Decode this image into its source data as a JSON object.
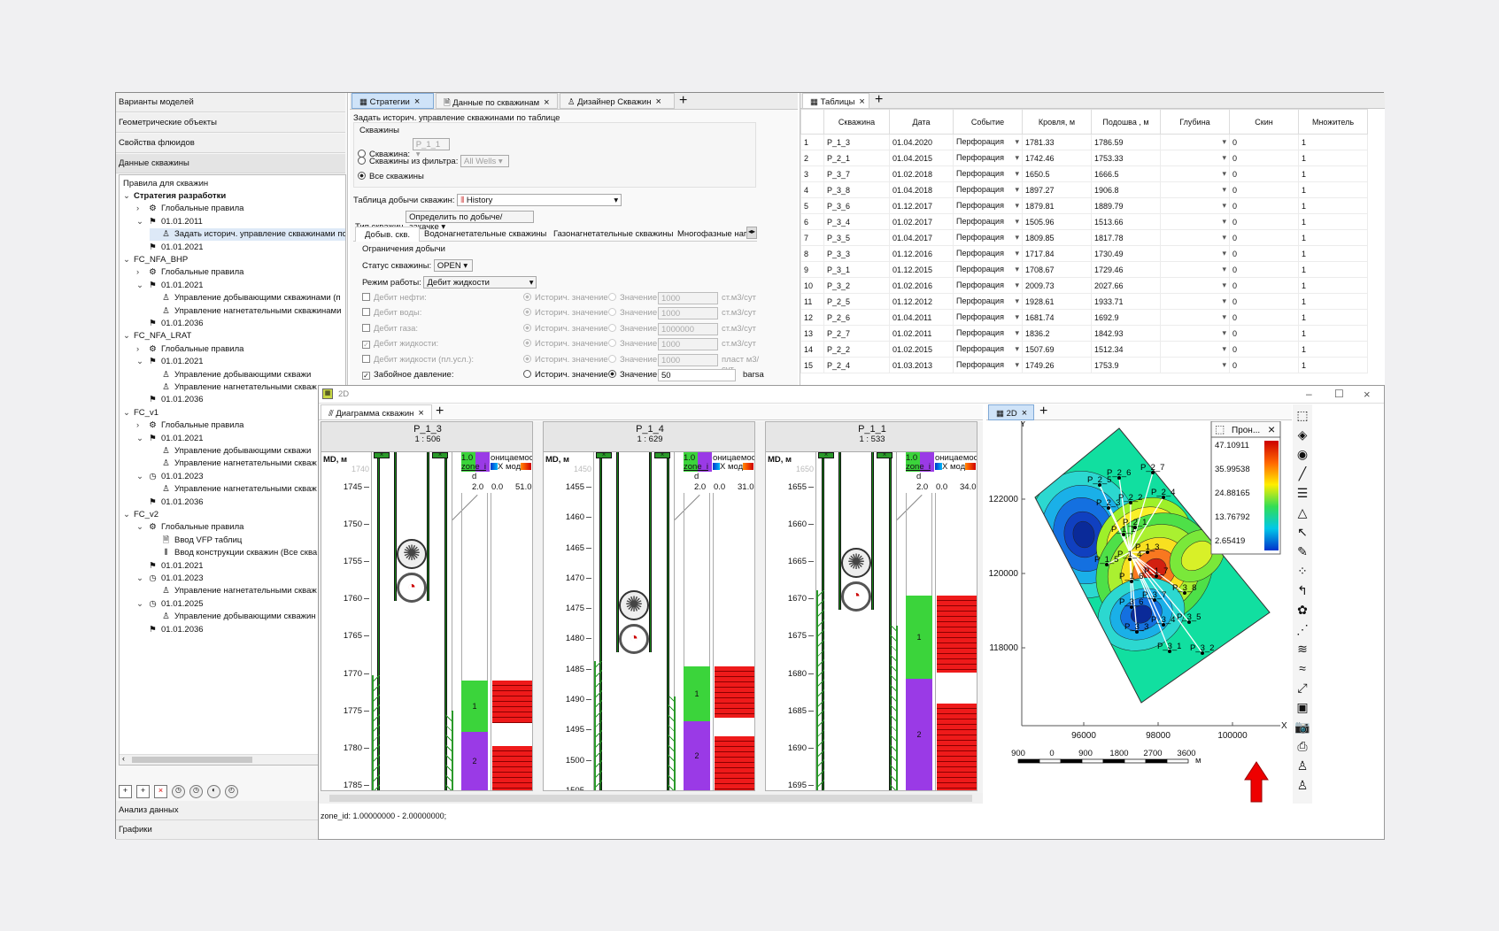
{
  "left_panel": {
    "sections": [
      "Варианты моделей",
      "Геометрические объекты",
      "Свойства флюидов",
      "Данные скважины"
    ],
    "tree_title": "Правила для скважин",
    "tree": [
      {
        "label": "Стратегия разработки",
        "bold": true
      },
      {
        "label": "Глобальные правила"
      },
      {
        "label": "01.01.2011"
      },
      {
        "label": "Задать историч. управление скважинами по"
      },
      {
        "label": "01.01.2021"
      },
      {
        "label": "FC_NFA_BHP"
      },
      {
        "label": "Глобальные правила"
      },
      {
        "label": "01.01.2021"
      },
      {
        "label": "Управление добывающими скважинами (п"
      },
      {
        "label": "Управление нагнетательными скважинами"
      },
      {
        "label": "01.01.2036"
      },
      {
        "label": "FC_NFA_LRAT"
      },
      {
        "label": "Глобальные правила"
      },
      {
        "label": "01.01.2021"
      },
      {
        "label": "Управление добывающими скважи"
      },
      {
        "label": "Управление нагнетательными скваж"
      },
      {
        "label": "01.01.2036"
      },
      {
        "label": "FC_v1"
      },
      {
        "label": "Глобальные правила"
      },
      {
        "label": "01.01.2021"
      },
      {
        "label": "Управление добывающими скважи"
      },
      {
        "label": "Управление нагнетательными скваж"
      },
      {
        "label": "01.01.2023"
      },
      {
        "label": "Управление нагнетательными скваж"
      },
      {
        "label": "01.01.2036"
      },
      {
        "label": "FC_v2"
      },
      {
        "label": "Глобальные правила"
      },
      {
        "label": "Ввод VFP таблиц"
      },
      {
        "label": "Ввод конструкции скважин (Все сква"
      },
      {
        "label": "01.01.2021"
      },
      {
        "label": "01.01.2023"
      },
      {
        "label": "Управление нагнетательными скваж"
      },
      {
        "label": "01.01.2025"
      },
      {
        "label": "Управление добывающими скважин"
      },
      {
        "label": "01.01.2036"
      }
    ],
    "bottom_sections": [
      "Анализ данных",
      "Графики"
    ]
  },
  "strategy_tabs": [
    "Стратегии",
    "Данные по скважинам",
    "Дизайнер Скважин"
  ],
  "strategy": {
    "title": "Задать историч. управление скважинами по таблице",
    "wells_group": "Скважины",
    "opt_well": "Скважина:",
    "opt_well_value": "P_1_1",
    "opt_filter": "Скважины из фильтра:",
    "opt_filter_value": "All Wells",
    "opt_all": "Все скважины",
    "table_label": "Таблица добычи скважин:",
    "table_value": "History",
    "type_label": "Тип скважин",
    "type_value": "Определить по добыче/закачке",
    "subtabs": [
      "Добыв. скв.",
      "Водонагнетательные скважины",
      "Газонагнетательные скважины",
      "Многофазные наг"
    ],
    "limits_title": "Ограничения добычи",
    "status_label": "Статус скважины:",
    "status_value": "OPEN",
    "mode_label": "Режим работы:",
    "mode_value": "Дебит жидкости",
    "hist_label": "Историч. значение",
    "val_label": "Значение",
    "rows": [
      {
        "name": "Дебит нефти:",
        "value": "1000",
        "unit": "ст.м3/сут"
      },
      {
        "name": "Дебит воды:",
        "value": "1000",
        "unit": "ст.м3/сут"
      },
      {
        "name": "Дебит газа:",
        "value": "1000000",
        "unit": "ст.м3/сут"
      },
      {
        "name": "Дебит жидкости:",
        "value": "1000",
        "unit": "ст.м3/сут"
      },
      {
        "name": "Дебит жидкости (пл.усл.):",
        "value": "1000",
        "unit": "пласт м3/сут"
      },
      {
        "name": "Забойное давление:",
        "value": "50",
        "unit": "barsa"
      }
    ]
  },
  "tables_tab": "Таблицы",
  "table": {
    "headers": [
      "",
      "Скважина",
      "Дата",
      "Событие",
      "Кровля, м",
      "Подошва , м",
      "Глубина",
      "Скин",
      "Множитель"
    ],
    "rows": [
      [
        "1",
        "P_1_3",
        "01.04.2020",
        "Перфорация",
        "1781.33",
        "1786.59",
        "",
        "0",
        "1"
      ],
      [
        "2",
        "P_2_1",
        "01.04.2015",
        "Перфорация",
        "1742.46",
        "1753.33",
        "",
        "0",
        "1"
      ],
      [
        "3",
        "P_3_7",
        "01.02.2018",
        "Перфорация",
        "1650.5",
        "1666.5",
        "",
        "0",
        "1"
      ],
      [
        "4",
        "P_3_8",
        "01.04.2018",
        "Перфорация",
        "1897.27",
        "1906.8",
        "",
        "0",
        "1"
      ],
      [
        "5",
        "P_3_6",
        "01.12.2017",
        "Перфорация",
        "1879.81",
        "1889.79",
        "",
        "0",
        "1"
      ],
      [
        "6",
        "P_3_4",
        "01.02.2017",
        "Перфорация",
        "1505.96",
        "1513.66",
        "",
        "0",
        "1"
      ],
      [
        "7",
        "P_3_5",
        "01.04.2017",
        "Перфорация",
        "1809.85",
        "1817.78",
        "",
        "0",
        "1"
      ],
      [
        "8",
        "P_3_3",
        "01.12.2016",
        "Перфорация",
        "1717.84",
        "1730.49",
        "",
        "0",
        "1"
      ],
      [
        "9",
        "P_3_1",
        "01.12.2015",
        "Перфорация",
        "1708.67",
        "1729.46",
        "",
        "0",
        "1"
      ],
      [
        "10",
        "P_3_2",
        "01.02.2016",
        "Перфорация",
        "2009.73",
        "2027.66",
        "",
        "0",
        "1"
      ],
      [
        "11",
        "P_2_5",
        "01.12.2012",
        "Перфорация",
        "1928.61",
        "1933.71",
        "",
        "0",
        "1"
      ],
      [
        "12",
        "P_2_6",
        "01.04.2011",
        "Перфорация",
        "1681.74",
        "1692.9",
        "",
        "0",
        "1"
      ],
      [
        "13",
        "P_2_7",
        "01.02.2011",
        "Перфорация",
        "1836.2",
        "1842.93",
        "",
        "0",
        "1"
      ],
      [
        "14",
        "P_2_2",
        "01.02.2015",
        "Перфорация",
        "1507.69",
        "1512.34",
        "",
        "0",
        "1"
      ],
      [
        "15",
        "P_2_4",
        "01.03.2013",
        "Перфорация",
        "1749.26",
        "1753.9",
        "",
        "0",
        "1"
      ]
    ]
  },
  "window_2d": {
    "title": "2D",
    "diagram_tab": "Диаграмма скважин",
    "map_tab": "2D",
    "status": "zone_id: 1.00000000 - 2.00000000;"
  },
  "tracks": [
    {
      "well": "P_1_3",
      "scale": "1 : 506",
      "ticks": [
        "1745",
        "1750",
        "1755",
        "1760",
        "1765",
        "1770",
        "1775",
        "1780",
        "1785"
      ],
      "top_tick": "1740",
      "right_val": "51.0"
    },
    {
      "well": "P_1_4",
      "scale": "1 : 629",
      "ticks": [
        "1455",
        "1460",
        "1465",
        "1470",
        "1475",
        "1480",
        "1485",
        "1490",
        "1495",
        "1500",
        "1505"
      ],
      "top_tick": "1450",
      "right_val": "31.0"
    },
    {
      "well": "P_1_1",
      "scale": "1 : 533",
      "ticks": [
        "1655",
        "1660",
        "1665",
        "1670",
        "1675",
        "1680",
        "1685",
        "1690",
        "1695"
      ],
      "top_tick": "1650",
      "right_val": "34.0"
    }
  ],
  "track_labels": {
    "md": "MD, м",
    "zone": "zone_i",
    "zone_val": "1.0",
    "zone_d": "d",
    "zone_min": "2.0",
    "perm": "оницаемос",
    "mod": "X мод",
    "zero": "0.0",
    "z1": "1",
    "z2": "2"
  },
  "map": {
    "y_label": "Y",
    "x_label": "X",
    "y_ticks": [
      "122000",
      "120000",
      "118000"
    ],
    "x_ticks": [
      "96000",
      "98000",
      "100000"
    ],
    "legend_title": "Прон...",
    "legend_values": [
      "47.10911",
      "35.99538",
      "24.88165",
      "13.76792",
      "2.65419"
    ],
    "scalebar": [
      "900",
      "0",
      "900",
      "1800",
      "2700",
      "3600"
    ],
    "scalebar_unit": "м",
    "wells": [
      "P_2_5",
      "P_2_6",
      "P_2_7",
      "P_2_3",
      "P_2_2",
      "P_2_4",
      "P_2_1",
      "P_1_1",
      "P_1_3",
      "P_1_4",
      "P_1_5",
      "P_1_6",
      "P_1_7",
      "P_3_6",
      "P_3_7",
      "P_3_8",
      "P_3_5",
      "P_3_3",
      "P_3_4",
      "P_3_1",
      "P_3_2"
    ]
  }
}
